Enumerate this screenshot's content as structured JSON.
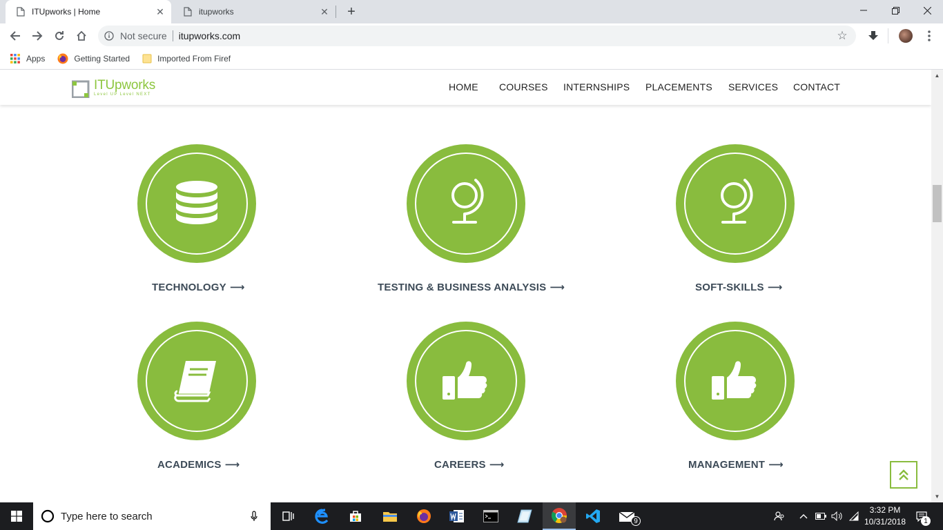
{
  "browser": {
    "tabs": [
      {
        "title": "ITUpworks | Home",
        "active": true
      },
      {
        "title": "itupworks",
        "active": false
      }
    ],
    "address_bar": {
      "security": "Not secure",
      "url": "itupworks.com"
    },
    "bookmarks": [
      {
        "label": "Apps",
        "icon": "apps-grid-icon"
      },
      {
        "label": "Getting Started",
        "icon": "firefox-icon"
      },
      {
        "label": "Imported From Firefox",
        "icon": "folder-icon"
      }
    ]
  },
  "site": {
    "logo": {
      "name": "ITUpworks",
      "tagline": "Level UP Level NEXT"
    },
    "nav": [
      "HOME",
      "COURSES",
      "INTERNSHIPS",
      "PLACEMENTS",
      "SERVICES",
      "CONTACT"
    ],
    "cards": [
      {
        "label": "TECHNOLOGY",
        "icon": "database-icon"
      },
      {
        "label": "TESTING & BUSINESS ANALYSIS",
        "icon": "globe-icon"
      },
      {
        "label": "SOFT-SKILLS",
        "icon": "globe-icon"
      },
      {
        "label": "ACADEMICS",
        "icon": "book-icon"
      },
      {
        "label": "CAREERS",
        "icon": "thumbs-up-icon"
      },
      {
        "label": "MANAGEMENT",
        "icon": "thumbs-up-icon"
      }
    ],
    "arrow": "⟶",
    "accent_color": "#89bc3e"
  },
  "taskbar": {
    "search_placeholder": "Type here to search",
    "time": "3:32 PM",
    "date": "10/31/2018",
    "mail_badge": "9",
    "notification_badge": "1"
  }
}
